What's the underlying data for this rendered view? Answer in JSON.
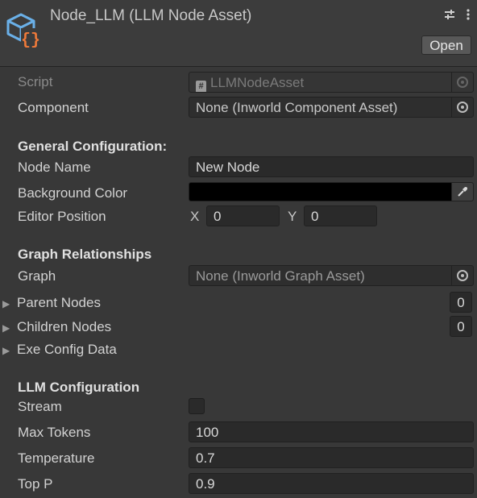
{
  "header": {
    "title": "Node_LLM (LLM Node Asset)",
    "open_label": "Open",
    "icons": [
      "asset-cube-icon",
      "preset-sliders-icon",
      "more-vertical-icon"
    ]
  },
  "colors": {
    "background": "#383838",
    "field": "#2a2a2a",
    "icon_cube": "#6ab0e8",
    "icon_braces": "#f07a3a",
    "background_color_value": "#000000"
  },
  "fields": {
    "script": {
      "label": "Script",
      "value": "LLMNodeAsset"
    },
    "component": {
      "label": "Component",
      "value": "None (Inworld Component Asset)"
    }
  },
  "general": {
    "title": "General Configuration:",
    "node_name_label": "Node Name",
    "node_name_value": "New Node",
    "bg_color_label": "Background Color",
    "editor_position_label": "Editor Position",
    "x_label": "X",
    "x_value": "0",
    "y_label": "Y",
    "y_value": "0"
  },
  "graph": {
    "title": "Graph Relationships",
    "graph_label": "Graph",
    "graph_value": "None (Inworld Graph Asset)",
    "parent_label": "Parent Nodes",
    "parent_count": "0",
    "children_label": "Children Nodes",
    "children_count": "0",
    "exe_label": "Exe Config Data"
  },
  "llm": {
    "title": "LLM Configuration",
    "stream_label": "Stream",
    "stream_checked": false,
    "max_tokens_label": "Max Tokens",
    "max_tokens_value": "100",
    "temperature_label": "Temperature",
    "temperature_value": "0.7",
    "top_p_label": "Top P",
    "top_p_value": "0.9"
  }
}
